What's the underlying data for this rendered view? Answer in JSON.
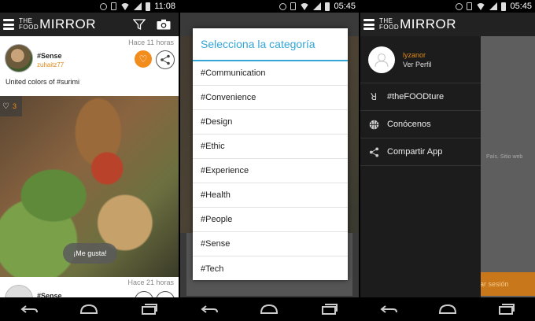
{
  "panel1": {
    "status": {
      "time": "11:08"
    },
    "logo": {
      "small_top": "THE",
      "small_bottom": "FOOD",
      "big": "MIRROR"
    },
    "post1": {
      "time": "Hace 11 horas",
      "tag": "#Sense",
      "user": "zuhaitz77",
      "caption": "United colors of #surimi",
      "likes": "3",
      "toast": "¡Me gusta!"
    },
    "post2": {
      "time": "Hace 21 horas",
      "tag": "#Sense"
    }
  },
  "panel2": {
    "status": {
      "time": "05:45"
    },
    "dialog": {
      "title": "Selecciona la categoría",
      "items": [
        "#Communication",
        "#Convenience",
        "#Design",
        "#Ethic",
        "#Experience",
        "#Health",
        "#People",
        "#Sense",
        "#Tech"
      ]
    }
  },
  "panel3": {
    "status": {
      "time": "05:45"
    },
    "profile": {
      "name": "lyzanor",
      "link": "Ver Perfil"
    },
    "menu": [
      {
        "icon": "fr-logo-icon",
        "label": "#theFOODture"
      },
      {
        "icon": "basketball-icon",
        "label": "Conócenos"
      },
      {
        "icon": "share-icon",
        "label": "Compartir App"
      }
    ],
    "background": {
      "text": "País. Sitio web",
      "logout": "rrar sesión"
    }
  },
  "colors": {
    "accent_orange": "#f28c1c",
    "dialog_blue": "#33a5d6"
  }
}
